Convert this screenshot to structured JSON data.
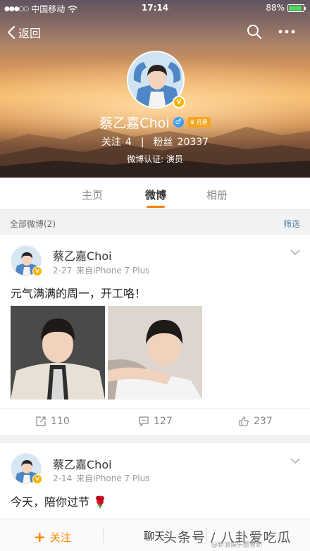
{
  "status_bar": {
    "carrier": "中国移动",
    "time": "17:14",
    "battery": "88%",
    "battery_level": 0.88
  },
  "nav": {
    "back_label": "返回"
  },
  "profile": {
    "name": "蔡乙嘉Choi",
    "gender_symbol": "♂",
    "vip_label": "月费",
    "following_label": "关注",
    "following_count": "4",
    "separator": "|",
    "followers_label": "粉丝",
    "followers_count": "20337",
    "certification": "微博认证: 演员",
    "verified_badge": "V"
  },
  "tabs": [
    {
      "label": "主页"
    },
    {
      "label": "微博"
    },
    {
      "label": "相册"
    }
  ],
  "filter": {
    "left": "全部微博(2)",
    "right": "筛选"
  },
  "posts": [
    {
      "author": "蔡乙嘉Choi",
      "date": "2-27",
      "source": "来自iPhone 7 Plus",
      "text": "元气满满的周一，开工咯！",
      "reposts": "110",
      "comments": "127",
      "likes": "237"
    },
    {
      "author": "蔡乙嘉Choi",
      "date": "2-14",
      "source": "来自iPhone 7 Plus",
      "text": "今天，陪你过节",
      "emoji": "🌹"
    }
  ],
  "bottom_bar": {
    "follow_label": "关注",
    "follow_icon": "+",
    "chat_label": "聊天"
  },
  "watermark": {
    "text": "头条号 / 八卦爱吃瓜",
    "sub": "@新浪娱乐圈看新"
  },
  "colors": {
    "accent": "#ff8200",
    "link": "#557ba7",
    "verified": "#f8b300"
  }
}
